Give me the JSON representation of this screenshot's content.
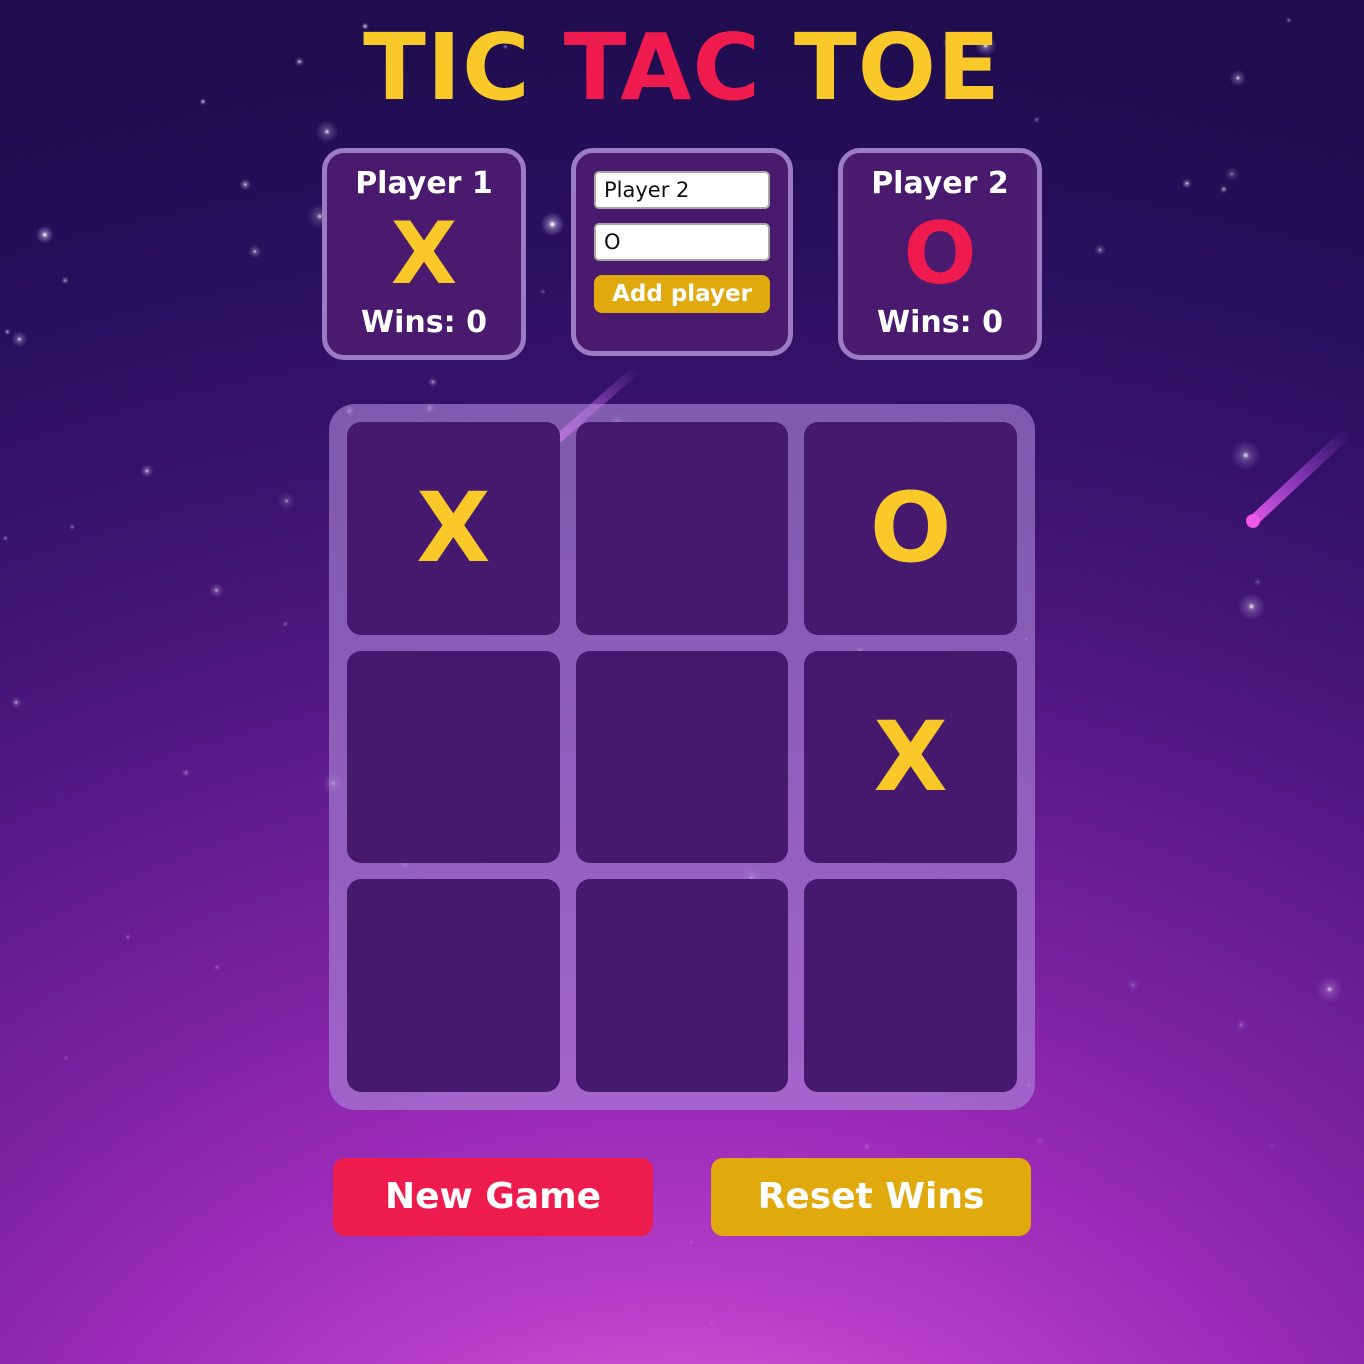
{
  "title": {
    "word1": "TIC",
    "word2": "TAC",
    "word3": "TOE"
  },
  "players": [
    {
      "name": "Player 1",
      "mark": "X",
      "wins_label": "Wins: 0",
      "wins": 0,
      "mark_color": "#f9c829"
    },
    {
      "name": "Player 2",
      "mark": "O",
      "wins_label": "Wins: 0",
      "wins": 0,
      "mark_color": "#ef1a4e"
    }
  ],
  "add_player": {
    "name_value": "Player 2",
    "name_placeholder": "Name",
    "symbol_value": "O",
    "symbol_placeholder": "Symbol",
    "button_label": "Add player"
  },
  "board": {
    "cells": [
      "X",
      "",
      "O",
      "",
      "",
      "X",
      "",
      "",
      ""
    ]
  },
  "footer": {
    "new_game_label": "New Game",
    "reset_wins_label": "Reset Wins"
  },
  "colors": {
    "gold": "#f9c829",
    "crimson": "#ef1a4e",
    "button_gold": "#e0a90d",
    "card_bg": "#4a1a6e",
    "card_border": "#9b7bc4",
    "cell_bg": "#451a6e",
    "board_bg": "#ac88d8"
  }
}
